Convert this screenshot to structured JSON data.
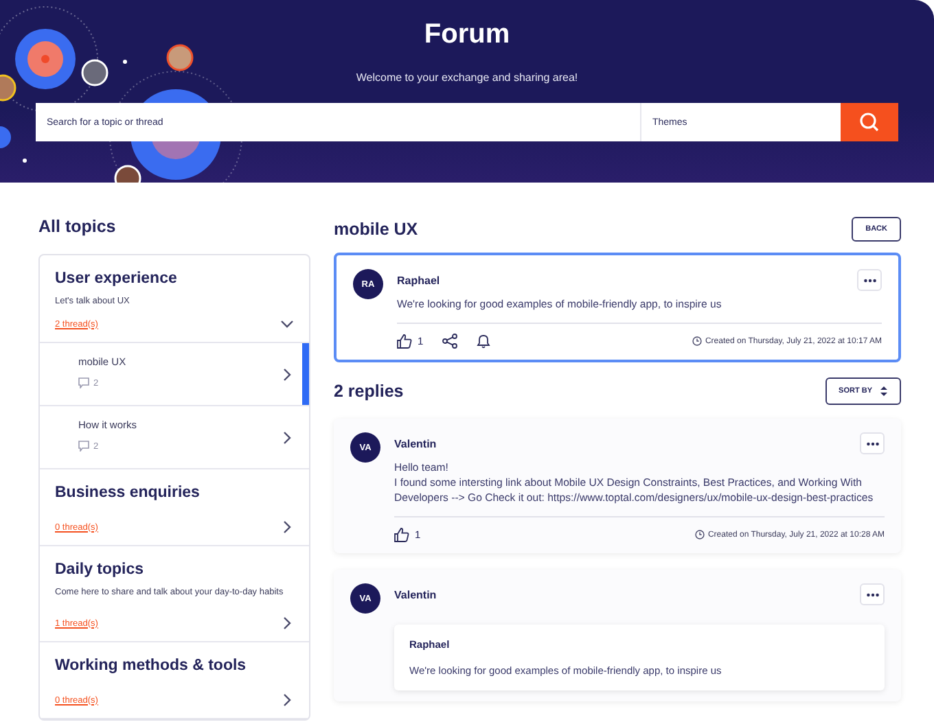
{
  "header": {
    "title": "Forum",
    "subtitle": "Welcome to your exchange and sharing area!",
    "search_placeholder": "Search for a topic or thread",
    "themes_placeholder": "Themes"
  },
  "sidebar": {
    "heading": "All topics",
    "topics": [
      {
        "title": "User experience",
        "description": "Let's talk about UX",
        "threads": "2 thread(s)",
        "expanded": true,
        "children": [
          {
            "title": "mobile UX",
            "comments": "2",
            "selected": true
          },
          {
            "title": "How it works",
            "comments": "2",
            "selected": false
          }
        ]
      },
      {
        "title": "Business enquiries",
        "threads": "0 thread(s)",
        "expanded": false
      },
      {
        "title": "Daily topics",
        "description": "Come here to share and talk about your day-to-day habits",
        "threads": "1 thread(s)",
        "expanded": false
      },
      {
        "title": "Working methods & tools",
        "threads": "0 thread(s)",
        "expanded": false
      }
    ]
  },
  "thread": {
    "title": "mobile UX",
    "back_label": "BACK",
    "post": {
      "initials": "RA",
      "author": "Raphael",
      "body": [
        "We're looking for good examples of mobile-friendly app, to inspire us"
      ],
      "likes": "1",
      "share": true,
      "notify": true,
      "date": "Created on Thursday, July 21, 2022 at 10:17 AM"
    },
    "replies_heading": "2 replies",
    "sort_label": "SORT BY",
    "replies": [
      {
        "initials": "VA",
        "author": "Valentin",
        "body": [
          "Hello team!",
          "I found some intersting link about Mobile UX Design Constraints, Best Practices, and Working With Developers --> Go Check it out: https://www.toptal.com/designers/ux/mobile-ux-design-best-practices"
        ],
        "likes": "1",
        "share": false,
        "notify": false,
        "date": "Created on Thursday, July 21, 2022 at 10:28 AM"
      },
      {
        "initials": "VA",
        "author": "Valentin",
        "quote": {
          "author": "Raphael",
          "body": "We're looking for good examples of mobile-friendly app, to inspire us"
        }
      }
    ]
  }
}
